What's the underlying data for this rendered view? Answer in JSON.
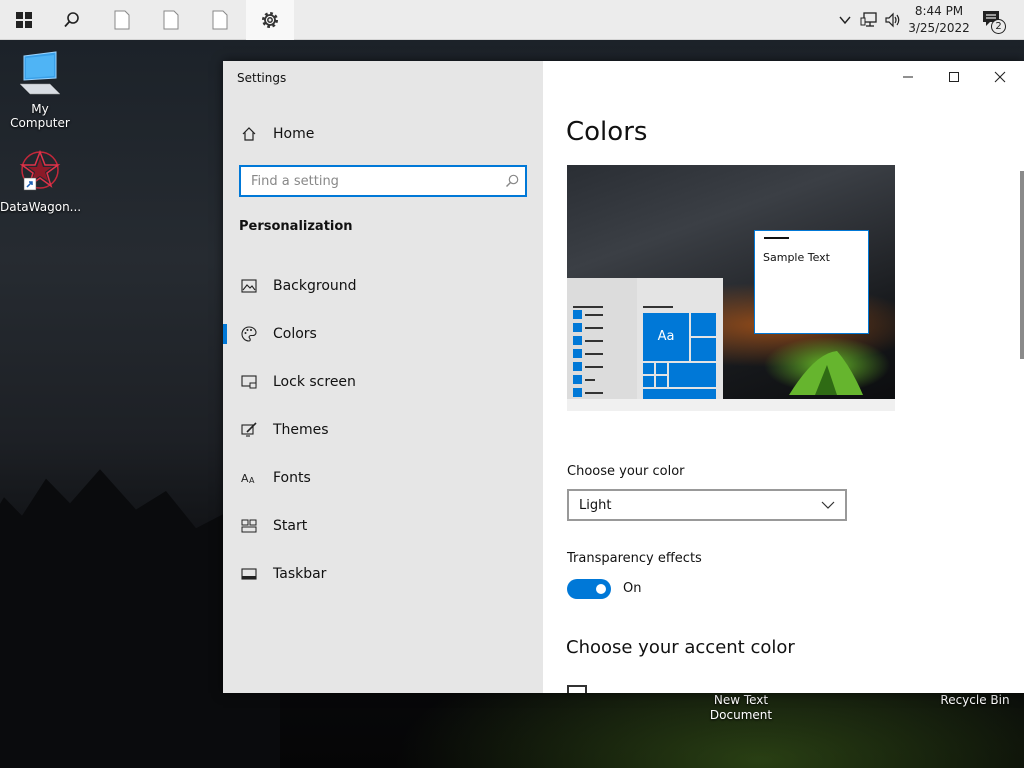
{
  "taskbar": {
    "start_icon": "windows-logo-icon",
    "search_icon": "search-icon",
    "pinned": [
      "document-icon",
      "document-icon",
      "document-icon",
      "gear-icon"
    ],
    "clock_time": "8:44 PM",
    "clock_date": "3/25/2022",
    "notification_count": "2"
  },
  "desktop": {
    "icons": [
      {
        "label": "My Computer",
        "icon": "computer-icon"
      },
      {
        "label": "DataWagon...",
        "icon": "datawagon-icon"
      }
    ],
    "bottom_icons": [
      {
        "label_line1": "New Text",
        "label_line2": "Document"
      },
      {
        "label": "Recycle Bin"
      }
    ]
  },
  "window": {
    "title": "Settings",
    "caption_buttons": [
      "minimize-icon",
      "maximize-icon",
      "close-icon"
    ]
  },
  "nav": {
    "home_label": "Home",
    "search_placeholder": "Find a setting",
    "section": "Personalization",
    "items": [
      {
        "label": "Background",
        "icon": "image-icon"
      },
      {
        "label": "Colors",
        "icon": "palette-icon",
        "selected": true
      },
      {
        "label": "Lock screen",
        "icon": "lock-screen-icon"
      },
      {
        "label": "Themes",
        "icon": "brush-icon"
      },
      {
        "label": "Fonts",
        "icon": "font-icon"
      },
      {
        "label": "Start",
        "icon": "start-icon"
      },
      {
        "label": "Taskbar",
        "icon": "taskbar-icon"
      }
    ]
  },
  "content": {
    "title": "Colors",
    "preview_sample_text": "Sample Text",
    "preview_tile_text": "Aa",
    "choose_color_label": "Choose your color",
    "choose_color_value": "Light",
    "transparency_label": "Transparency effects",
    "transparency_state": "On",
    "accent_heading": "Choose your accent color"
  },
  "colors": {
    "accent": "#0078d7",
    "nav_bg": "#e6e6e6"
  }
}
